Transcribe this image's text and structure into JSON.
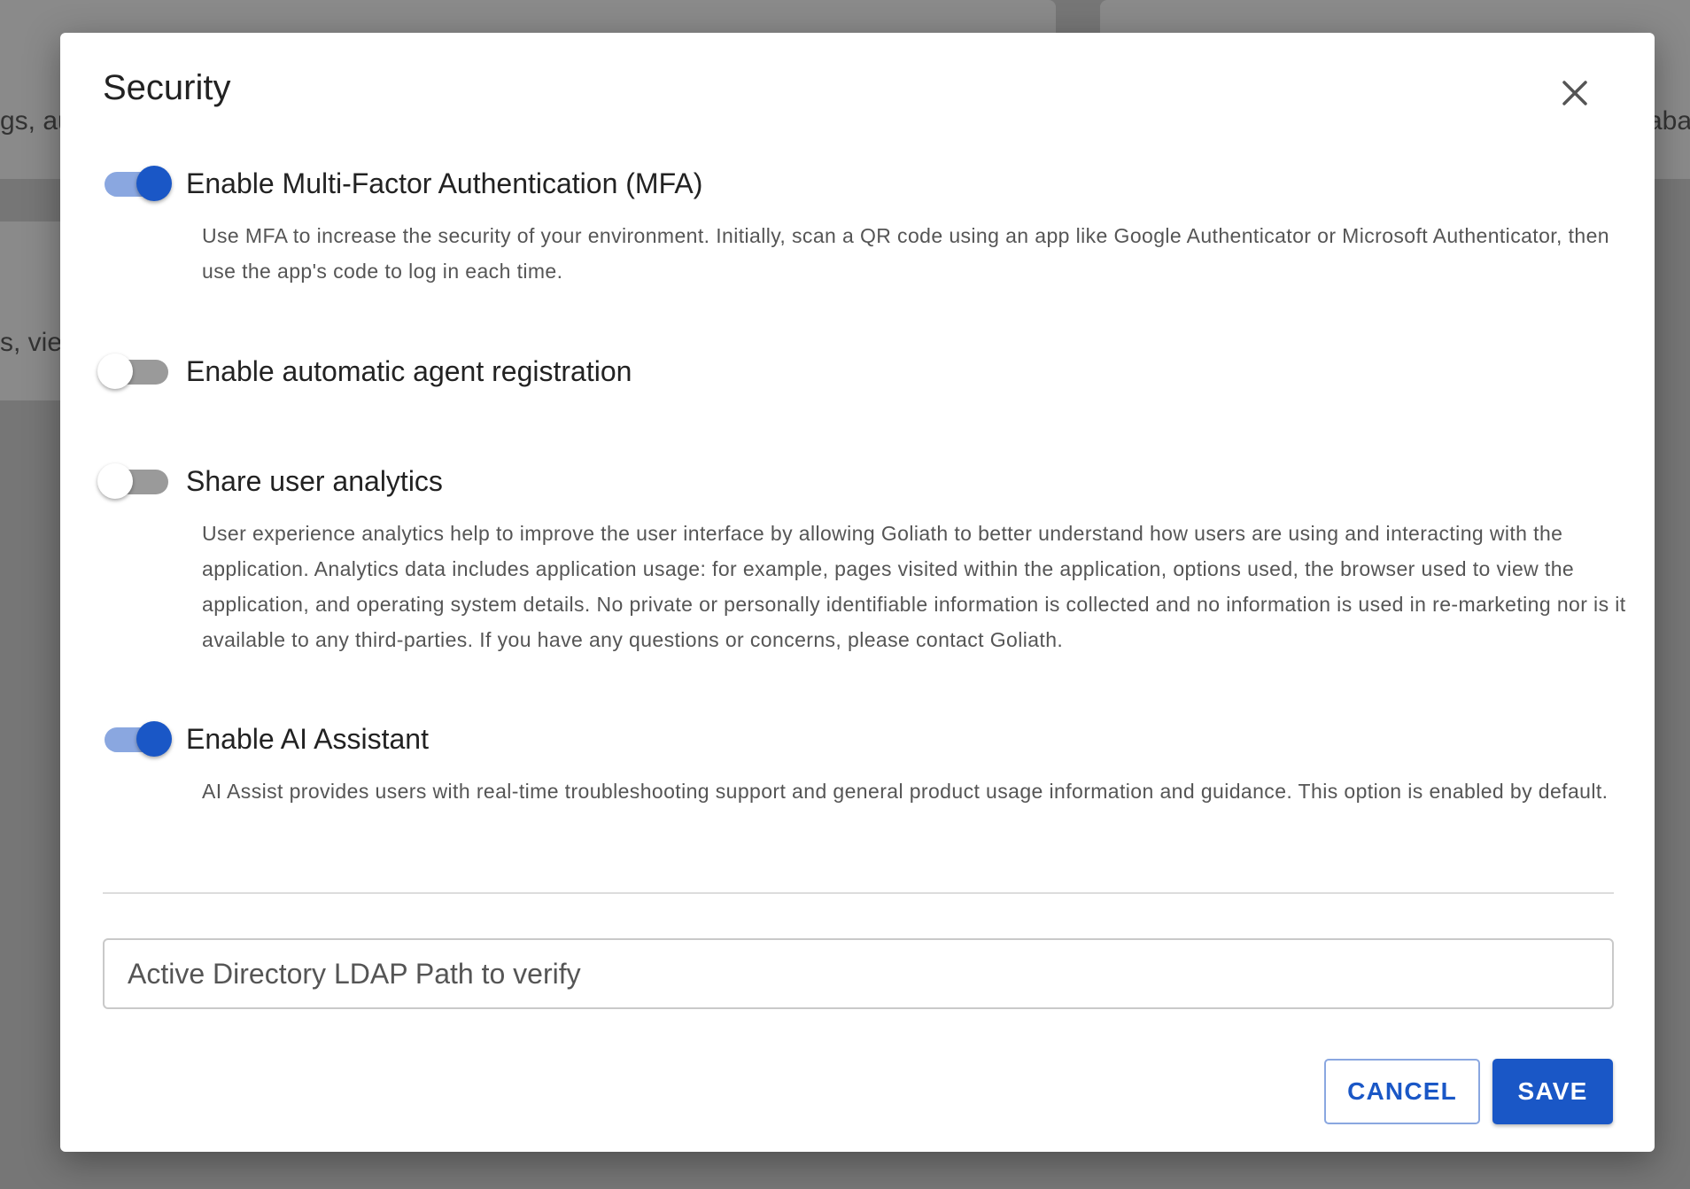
{
  "background": {
    "left_card_text_1": "gs, au",
    "left_card_text_2": "s, view",
    "right_card_text": "aba"
  },
  "modal": {
    "title": "Security",
    "close_icon": "close-icon"
  },
  "settings": [
    {
      "label": "Enable Multi-Factor Authentication (MFA)",
      "enabled": true,
      "description": "Use MFA to increase the security of your environment. Initially, scan a QR code using an app like Google Authenticator or Microsoft Authenticator, then use the app's code to log in each time."
    },
    {
      "label": "Enable automatic agent registration",
      "enabled": false,
      "description": ""
    },
    {
      "label": "Share user analytics",
      "enabled": false,
      "description": "User experience analytics help to improve the user interface by allowing Goliath to better understand how users are using and interacting with the application. Analytics data includes application usage: for example, pages visited within the application, options used, the browser used to view the application, and operating system details. No private or personally identifiable information is collected and no information is used in re-marketing nor is it available to any third-parties. If you have any questions or concerns, please contact Goliath."
    },
    {
      "label": "Enable AI Assistant",
      "enabled": true,
      "description": "AI Assist provides users with real-time troubleshooting support and general product usage information and guidance. This option is enabled by default."
    }
  ],
  "ldap": {
    "placeholder": "Active Directory LDAP Path to verify",
    "value": ""
  },
  "actions": {
    "cancel_label": "CANCEL",
    "save_label": "SAVE"
  },
  "colors": {
    "accent": "#1a57c6",
    "toggle_track_on": "#8aa7e0",
    "toggle_track_off": "#9a9a9a"
  }
}
